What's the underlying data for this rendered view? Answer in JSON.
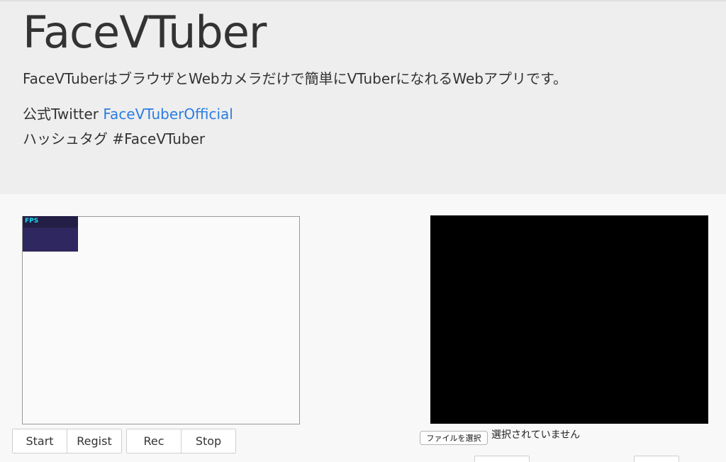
{
  "header": {
    "title": "FaceVTuber",
    "description": "FaceVTuberはブラウザとWebカメラだけで簡単にVTuberになれるWebアプリです。",
    "twitter_label": "公式Twitter ",
    "twitter_link": "FaceVTuberOfficial",
    "hashtag_line": "ハッシュタグ #FaceVTuber"
  },
  "stats_panel": {
    "label": "FPS",
    "label_color": "#19d9f0",
    "background": "#2a2350"
  },
  "controls": {
    "group1": [
      "Start",
      "Regist"
    ],
    "group2": [
      "Rec",
      "Stop"
    ]
  },
  "file_input": {
    "button_label": "ファイルを選択",
    "status": "選択されていません"
  },
  "colors": {
    "link": "#2a7de1",
    "hero_bg": "#eeeeee",
    "video_bg": "#000000"
  }
}
